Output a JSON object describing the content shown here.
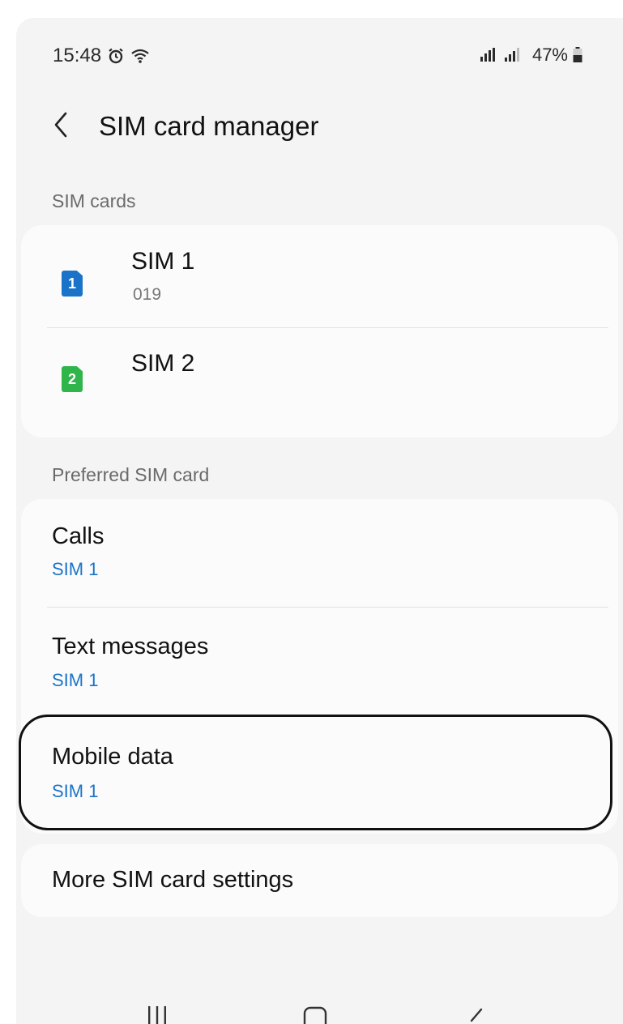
{
  "status_bar": {
    "time": "15:48",
    "battery": "47%",
    "icons": [
      "alarm-icon",
      "wifi-icon",
      "signal-icon",
      "battery-icon"
    ]
  },
  "header": {
    "title": "SIM card manager",
    "back_icon": "back-chevron-icon"
  },
  "sim_section": {
    "label": "SIM cards",
    "sims": [
      {
        "badge": "1",
        "name": "SIM 1",
        "number": "019",
        "color": "#1a73c8"
      },
      {
        "badge": "2",
        "name": "SIM 2",
        "number": "",
        "color": "#2fb54a"
      }
    ]
  },
  "preferred_section": {
    "label": "Preferred SIM card",
    "items": [
      {
        "title": "Calls",
        "value": "SIM 1"
      },
      {
        "title": "Text messages",
        "value": "SIM 1"
      },
      {
        "title": "Mobile data",
        "value": "SIM 1"
      }
    ]
  },
  "more": {
    "label": "More SIM card settings"
  },
  "nav_bar": {
    "buttons": [
      "recents-icon",
      "home-icon",
      "back-icon"
    ]
  },
  "colors": {
    "accent": "#1a73c8",
    "sim1": "#1a73c8",
    "sim2": "#2fb54a",
    "background": "#f4f4f4",
    "card": "#fbfbfb"
  }
}
